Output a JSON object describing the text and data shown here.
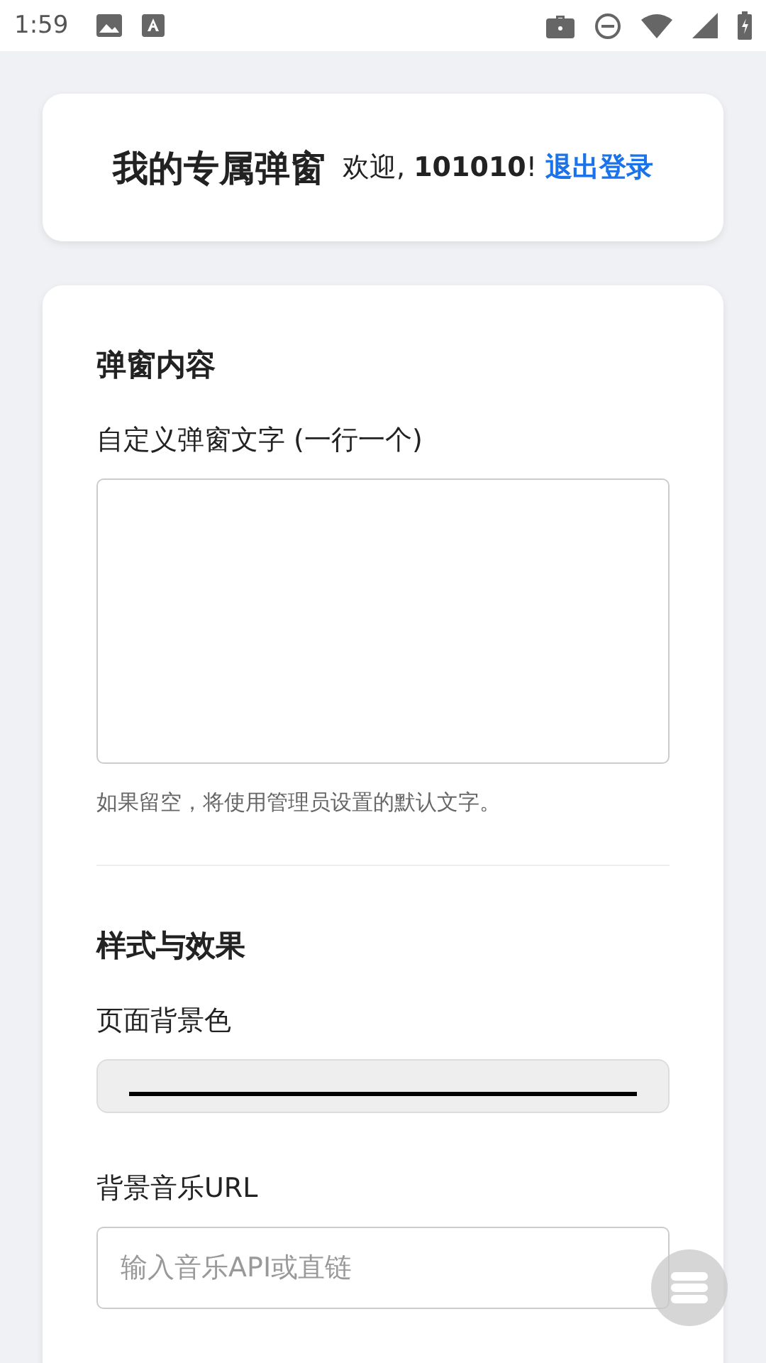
{
  "status_bar": {
    "time": "1:59"
  },
  "header": {
    "title": "我的专属弹窗",
    "welcome": "欢迎, **101010**!",
    "logout": "退出登录"
  },
  "sections": [
    {
      "heading": "弹窗内容",
      "fields": [
        {
          "kind": "textarea",
          "label": "自定义弹窗文字 (一行一个)",
          "hint": "如果留空，将使用管理员设置的默认文字。"
        }
      ]
    },
    {
      "heading": "样式与效果",
      "fields": [
        {
          "kind": "color",
          "label": "页面背景色",
          "color": "#000000"
        },
        {
          "kind": "text",
          "label": "背景音乐URL",
          "placeholder": "输入音乐API或直链"
        }
      ]
    }
  ]
}
